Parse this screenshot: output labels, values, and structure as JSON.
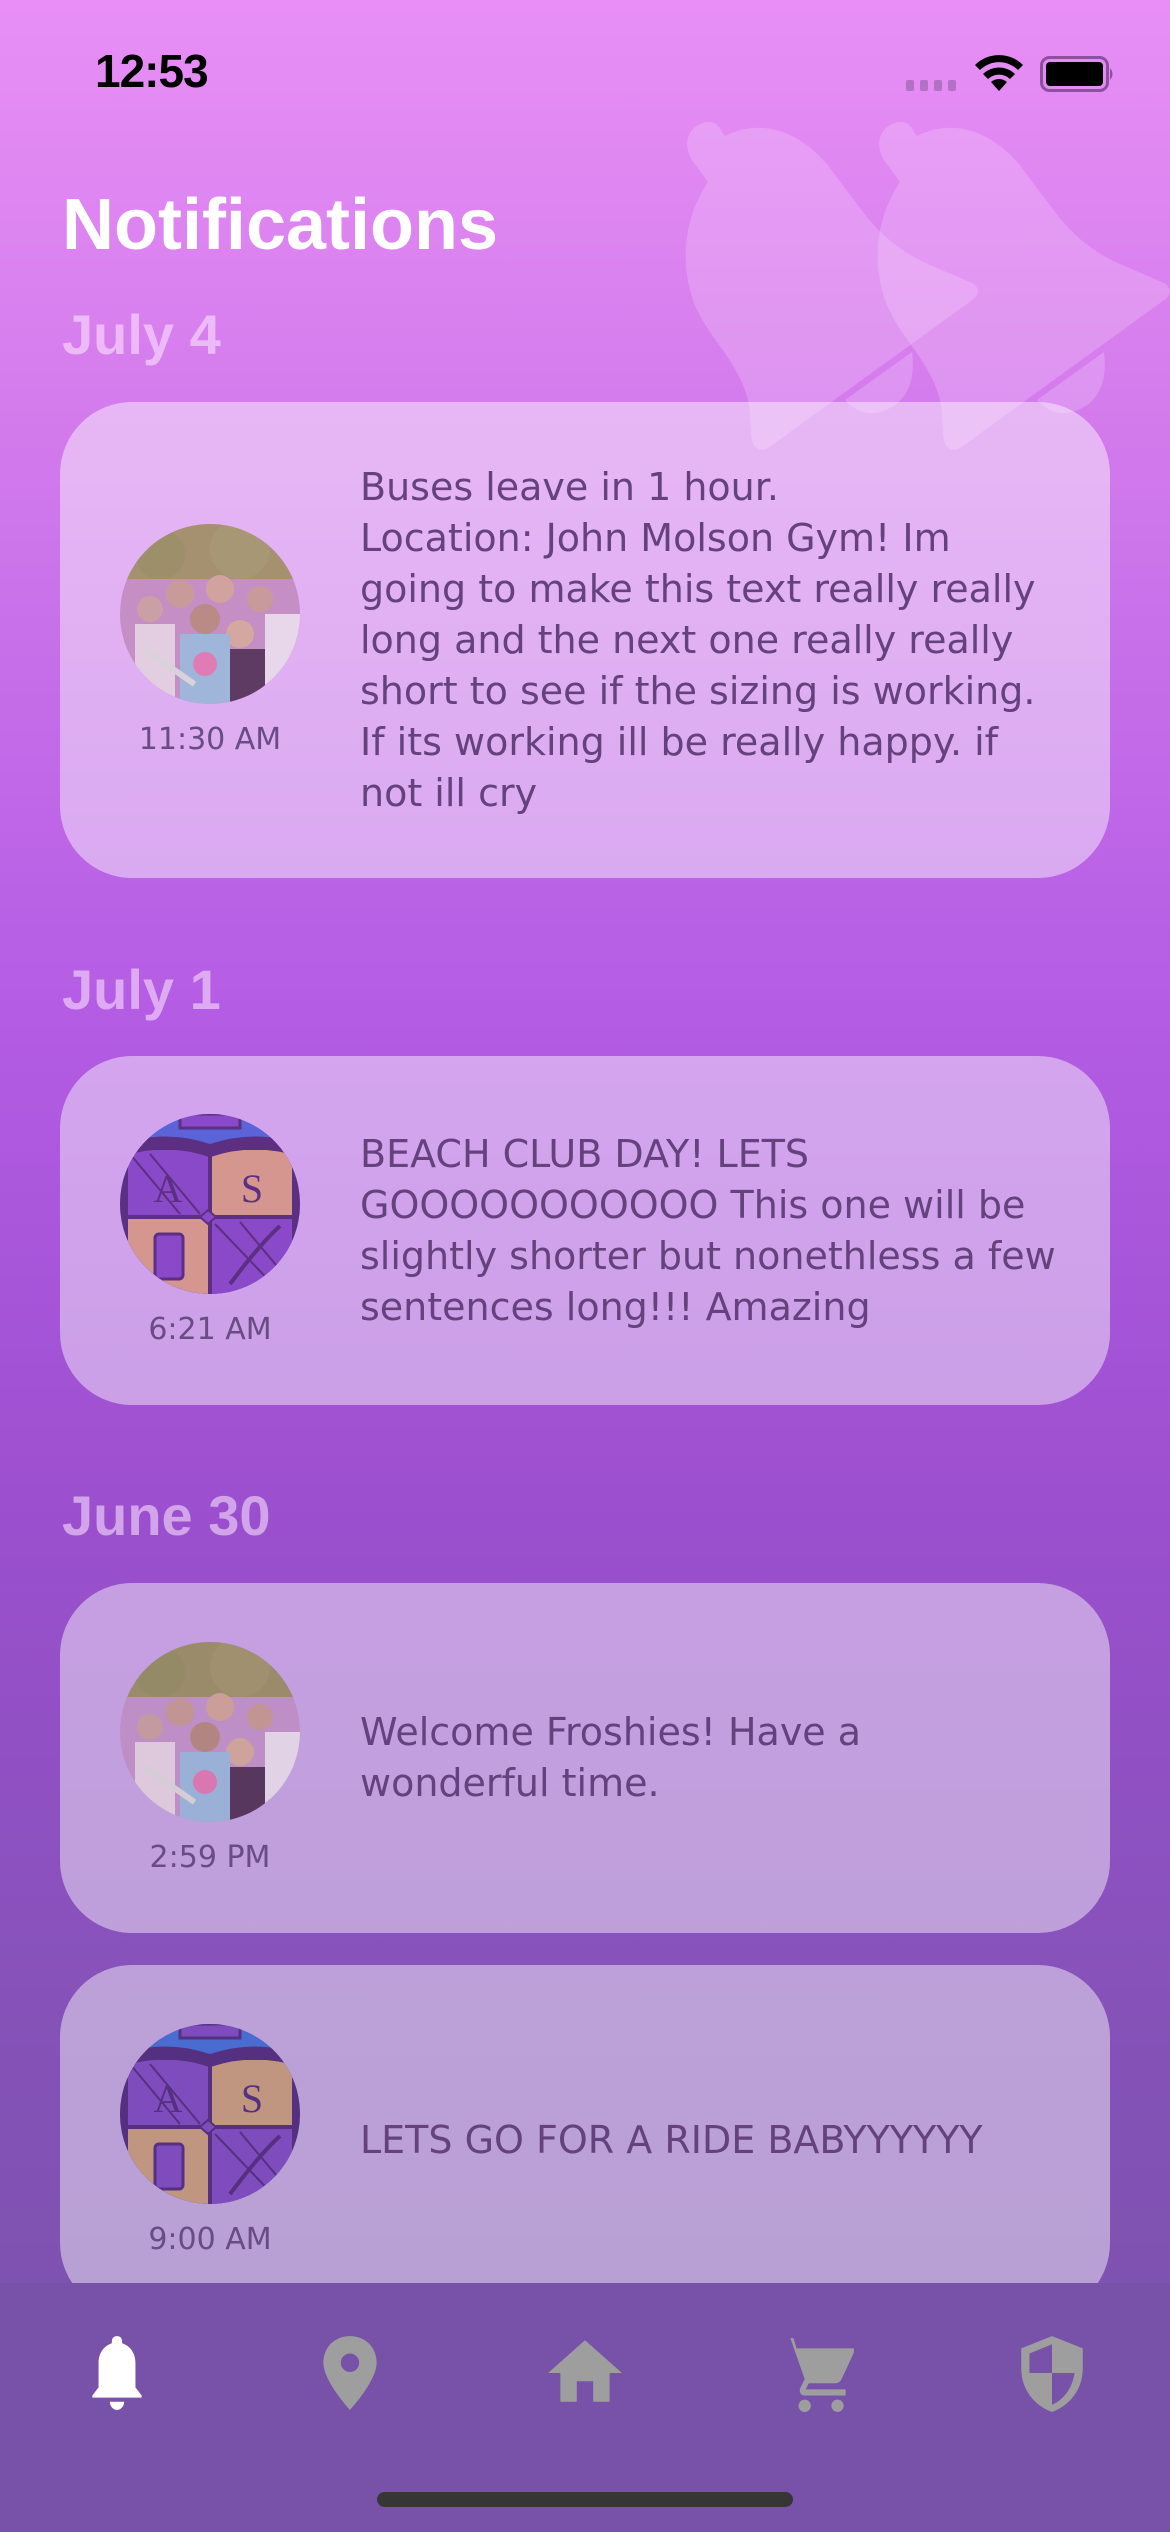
{
  "status_bar": {
    "time": "12:53"
  },
  "header": {
    "title": "Notifications"
  },
  "colors": {
    "accent_active": "#ffffff",
    "tab_inactive": "#9e9e9e",
    "tab_bar_bg": "#7852a9",
    "message_text": "#65427e"
  },
  "sections": [
    {
      "date": "July 4",
      "notifications": [
        {
          "avatar": "frosh-crowd-photo",
          "time": "11:30 AM",
          "message": "Buses leave in 1 hour.\nLocation: John Molson Gym! Im going to make this text really really long and the next one really really short to see if the sizing is working. If its working ill be really happy. if not ill cry"
        }
      ]
    },
    {
      "date": "July 1",
      "notifications": [
        {
          "avatar": "crest-logo",
          "time": "6:21 AM",
          "message": "BEACH CLUB DAY! LETS GOOOOOOOOOOO This one will be slightly shorter but nonethless a few sentences long!!! Amazing"
        }
      ]
    },
    {
      "date": "June 30",
      "notifications": [
        {
          "avatar": "frosh-crowd-photo",
          "time": "2:59 PM",
          "message": "Welcome Froshies! Have a wonderful time."
        },
        {
          "avatar": "crest-logo",
          "time": "9:00 AM",
          "message": "LETS GO FOR A RIDE BABYYYYYY"
        }
      ]
    }
  ],
  "tab_bar": {
    "items": [
      {
        "icon": "bell-icon",
        "label": "Notifications",
        "active": true
      },
      {
        "icon": "map-pin-icon",
        "label": "Map",
        "active": false
      },
      {
        "icon": "home-icon",
        "label": "Home",
        "active": false
      },
      {
        "icon": "cart-icon",
        "label": "Shop",
        "active": false
      },
      {
        "icon": "shield-icon",
        "label": "Safety",
        "active": false
      }
    ]
  }
}
